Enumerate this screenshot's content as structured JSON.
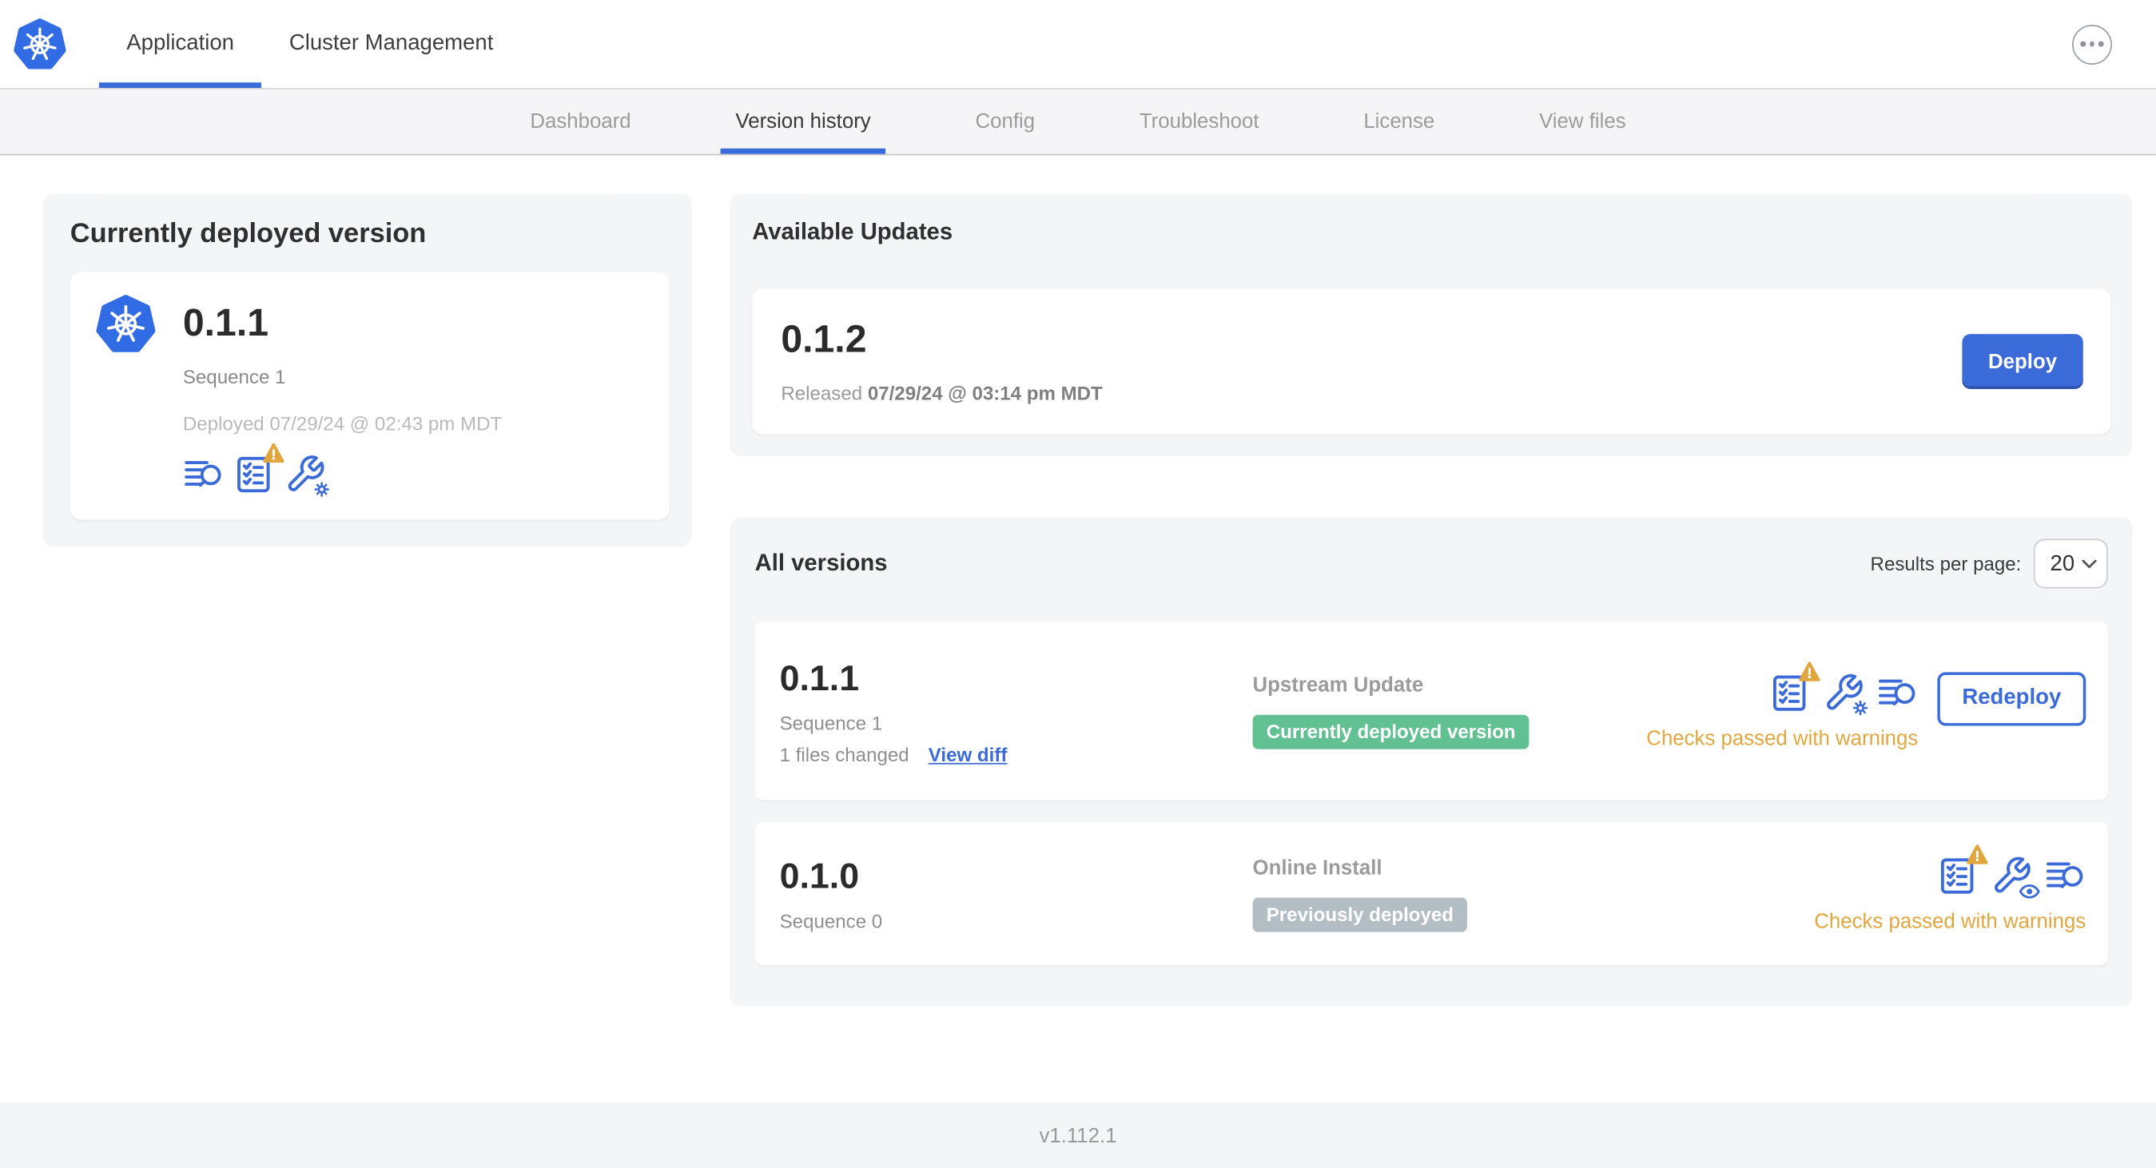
{
  "colors": {
    "accent": "#3b6ad9",
    "k8s_blue": "#326ce5",
    "green": "#62c193",
    "badge_gray": "#b3bec4",
    "amber": "#e1a63d",
    "card_bg": "#f4f5f7"
  },
  "topbar": {
    "tabs": [
      {
        "label": "Application",
        "active": true
      },
      {
        "label": "Cluster Management",
        "active": false
      }
    ],
    "more_menu_icon": "ellipsis-icon"
  },
  "nav": {
    "tabs": [
      {
        "label": "Dashboard",
        "active": false
      },
      {
        "label": "Version history",
        "active": true
      },
      {
        "label": "Config",
        "active": false
      },
      {
        "label": "Troubleshoot",
        "active": false
      },
      {
        "label": "License",
        "active": false
      },
      {
        "label": "View files",
        "active": false
      }
    ]
  },
  "deployed_card": {
    "title": "Currently deployed version",
    "version": "0.1.1",
    "sequence": "Sequence 1",
    "deployed_at": "Deployed 07/29/24 @ 02:43 pm MDT",
    "icons": [
      "diff-logs-icon",
      "preflight-checks-warning-icon",
      "config-wrench-gear-icon"
    ]
  },
  "available_updates": {
    "title": "Available Updates",
    "version": "0.1.2",
    "released_prefix": "Released ",
    "released_at": "07/29/24 @ 03:14 pm MDT",
    "deploy_label": "Deploy"
  },
  "all_versions": {
    "title": "All versions",
    "results_per_page_label": "Results per page:",
    "results_per_page_value": "20",
    "rows": [
      {
        "version": "0.1.1",
        "sequence": "Sequence 1",
        "files_changed": "1 files changed",
        "view_diff_label": "View diff",
        "source": "Upstream Update",
        "badge_label": "Currently deployed version",
        "badge_style": "green",
        "checks_status": "Checks passed with warnings",
        "action_label": "Redeploy",
        "icons": [
          "preflight-checks-warning-icon",
          "config-wrench-gear-icon",
          "diff-logs-icon"
        ]
      },
      {
        "version": "0.1.0",
        "sequence": "Sequence 0",
        "source": "Online Install",
        "badge_label": "Previously deployed",
        "badge_style": "gray",
        "checks_status": "Checks passed with warnings",
        "icons": [
          "preflight-checks-warning-icon",
          "config-wrench-eye-icon",
          "diff-logs-icon"
        ]
      }
    ]
  },
  "footer": {
    "app_version": "v1.112.1"
  }
}
